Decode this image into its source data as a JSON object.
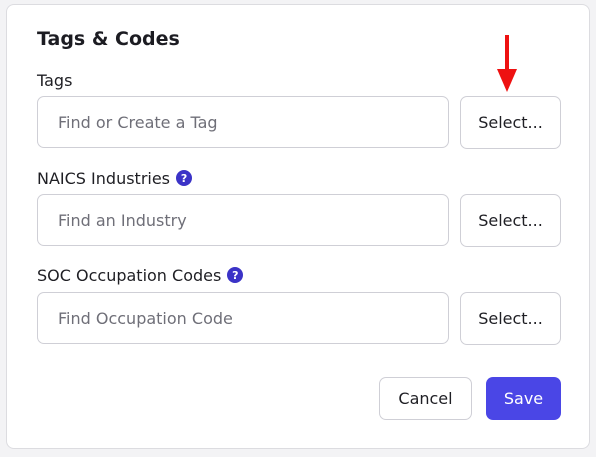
{
  "dialog": {
    "title": "Tags & Codes"
  },
  "tags": {
    "label": "Tags",
    "placeholder": "Find or Create a Tag",
    "select_label": "Select..."
  },
  "naics": {
    "label": "NAICS Industries",
    "placeholder": "Find an Industry",
    "select_label": "Select..."
  },
  "soc": {
    "label": "SOC Occupation Codes",
    "placeholder": "Find Occupation Code",
    "select_label": "Select..."
  },
  "footer": {
    "cancel_label": "Cancel",
    "save_label": "Save"
  },
  "icons": {
    "help": "question-mark-icon",
    "annotation": "red-down-arrow"
  },
  "colors": {
    "primary": "#4a46e6",
    "help_icon": "#3b33c7",
    "annotation_arrow": "#ee1111",
    "border": "#cfcfd6"
  }
}
